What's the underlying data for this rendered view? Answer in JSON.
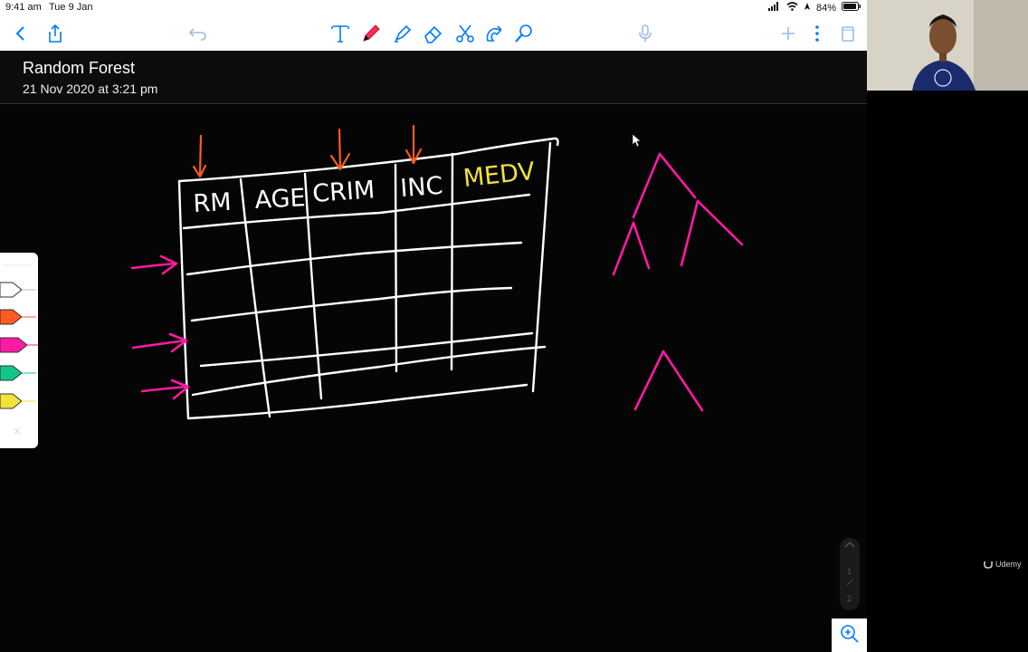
{
  "status_bar": {
    "time": "9:41 am",
    "date": "Tue 9 Jan",
    "battery": "84%"
  },
  "note": {
    "title": "Random Forest",
    "timestamp": "21 Nov 2020 at 3:21 pm"
  },
  "table_headers": [
    "RM",
    "AGE",
    "CRIM",
    "INC",
    "MEDV"
  ],
  "page_indicator": {
    "current": "1",
    "total": "2"
  },
  "watermark": "Udemy",
  "colors": {
    "pen_white": "#ffffff",
    "pen_pink": "#ff1aa3",
    "pen_orange": "#ff5a1f",
    "pen_yellow": "#f2e23a",
    "toolbar_active": "#ff2d55"
  }
}
